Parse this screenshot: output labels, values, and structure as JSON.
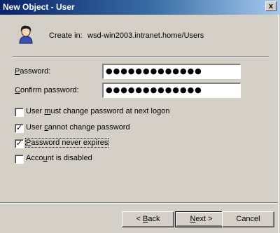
{
  "window": {
    "title": "New Object - User",
    "close_label": "x"
  },
  "header": {
    "create_in_label": "Create in:",
    "container_path": "wsd-win2003.intranet.home/Users"
  },
  "fields": {
    "password": {
      "label_key": "P",
      "label_rest": "assword:",
      "value": "●●●●●●●●●●●●●"
    },
    "confirm": {
      "label_key": "C",
      "label_rest": "onfirm password:",
      "value": "●●●●●●●●●●●●●"
    }
  },
  "options": [
    {
      "pre": "User ",
      "key": "m",
      "post": "ust change password at next logon",
      "checked": false,
      "mark": ""
    },
    {
      "pre": "User ",
      "key": "c",
      "post": "annot change password",
      "checked": true,
      "mark": "✓"
    },
    {
      "pre": "",
      "key": "P",
      "post": "assword never expires",
      "checked": true,
      "mark": "✓"
    },
    {
      "pre": "Acco",
      "key": "u",
      "post": "nt is disabled",
      "checked": false,
      "mark": ""
    }
  ],
  "buttons": {
    "back": {
      "pre": "< ",
      "key": "B",
      "post": "ack"
    },
    "next": {
      "pre": "",
      "key": "N",
      "post": "ext >"
    },
    "cancel": {
      "label": "Cancel"
    }
  },
  "colors": {
    "title_bar": "#0a246a",
    "face": "#d4d0c8"
  }
}
